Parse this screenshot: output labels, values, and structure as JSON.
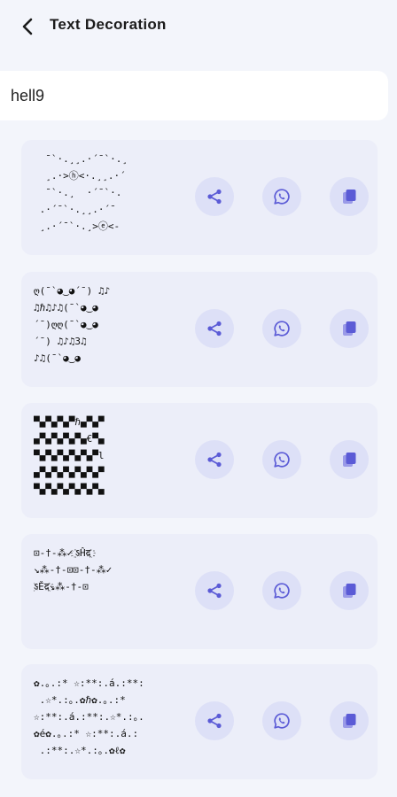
{
  "header": {
    "title": "Text Decoration"
  },
  "input": {
    "value": "hell9"
  },
  "colors": {
    "accent": "#5b5bd6",
    "icon_bg": "#dde0f7",
    "card_bg": "#eceef9"
  },
  "cards": [
    {
      "lines": [
        "  ¯`·.¸¸.·´¯`·.¸",
        "  ¸.·>ⓗ<·.¸¸.·´",
        "  ¯`·.¸  ·´¯`·.",
        " .·´¯`·.¸¸.·´¯",
        " ¸.·´¯`·.¸>ⓔ<-"
      ]
    },
    {
      "lines": [
        "ღ(¯`◕‿◕´¯) ♫♪",
        "♫ℏ♫♪♫(¯`◕‿◕",
        "´¯)ღღ(¯`◕‿◕",
        "´¯) ♫♪♫3♫",
        "♪♫(¯`◕‿◕"
      ]
    },
    {
      "lines": [
        "▀▄▀▄▀▄▀ℏ▄▀▄▀",
        "▄▀▄▀▄▀▄▀▄€▀▄",
        "▀▄▀▄▀▄▀▄▀▄▀l",
        "▄▀▄▀▄▀▄▀▄▀▄▀",
        "▀▄▀▄▀▄▀▄▀▄▀▄"
      ]
    },
    {
      "lines": [
        "⊡-†-⁂✓ ҈ऽĤद҈",
        "",
        "↘⁂-†-⊡⊡-†-⁂✓",
        "",
        "҈ऽĚद҈↘⁂-†-⊡"
      ]
    },
    {
      "lines": [
        "✿.｡.:* ☆:**:.á.:**:",
        " .☆*.:｡.✿ℏ✿.｡.:*",
        "☆:**:.á.:**:.☆*.:｡.",
        "✿é✿.｡.:* ☆:**:.á.:",
        " .:**:.☆*.:｡.✿ℓ✿"
      ]
    }
  ]
}
